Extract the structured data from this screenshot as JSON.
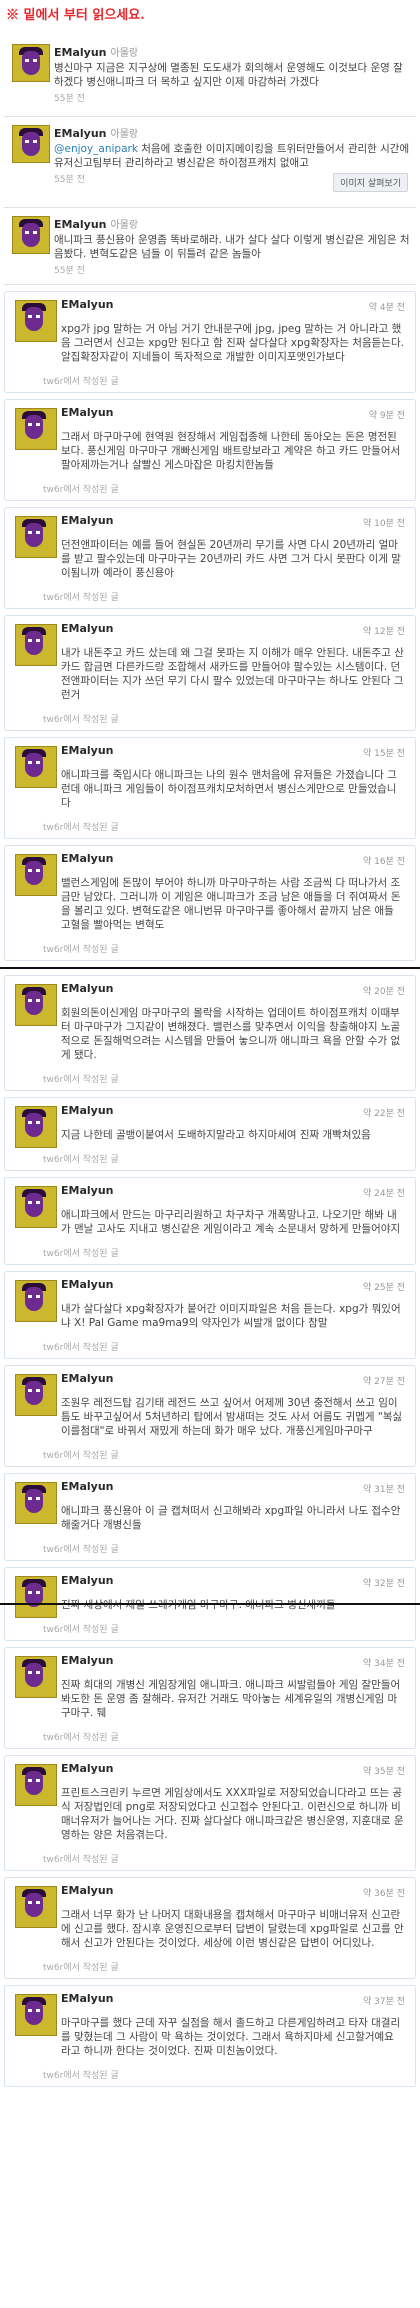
{
  "banner": "※ 밑에서 부터 읽으세요.",
  "top_items": [
    {
      "name": "EMalyun",
      "time_inline": "아몰랑",
      "text_parts": [
        "병신마구 지금은 지구상에 멸종된 도도새가 회의해서 운영해도 이것보다 운영 잘하겠다 병신애니파크 더 목하고 싶지만 이제 마감하러 가겠다"
      ],
      "meta": "55분 전"
    },
    {
      "name": "EMalyun",
      "time_inline": "아몰랑",
      "mention": "@enjoy_anipark",
      "text_after": " 처음에 호출한 이미지메이킹을 트위터만들어서 관리한 시간에 유저신고팀부터 관리하라고 병신같은 하이점프캐치 없애고",
      "meta": "55분 전",
      "attach": "이미지 살펴보기"
    },
    {
      "name": "EMalyun",
      "time_inline": "아몰랑",
      "text_parts": [
        "애니파크 풍신용아 운영좀 똑바로해라. 내가 살다 살다 이렇게 병신같은 게임은 처음봤다. 변혁도같은 넘들 이 뒤틀려 같은 놈들아"
      ],
      "meta": "55분 전"
    }
  ],
  "tweets": [
    {
      "name": "EMalyun",
      "time": "약 4분 전",
      "text": "xpg가 jpg 말하는 거 아님 거기 안내문구에 jpg, jpeg 말하는 거 아니라고 했음 그러면서 신고는 xpg만 된다고 함 진짜 살다살다 xpg확장자는 처음듣는다. 알집확장자같이 지네들이 독자적으로 개발한 이미지포맷인가보다",
      "footer": "tw6r에서 작성된 글"
    },
    {
      "name": "EMalyun",
      "time": "약 9분 전",
      "text": "그래서 마구마구에 현역원 현장해서 게임접종해 나한테 동아오는 돈은 명전된 보다. 풍신게임 마구마구 개빠신게임 배트랑보라고 계약은 하고 카드 만들어서 팔아제까는거나 살빨신 게스마잡은 마킹치한놈들",
      "footer": "tw6r에서 작성된 글"
    },
    {
      "name": "EMalyun",
      "time": "약 10분 전",
      "text": "던전앤파이터는 예를 들어 현실돈 20년까리 무기를 사면 다시 20년까리 얼마를 받고 팔수있는데 마구마구는 20년까리 카드 사면 그거 다시 못판다 이게 말이됨니까 예라이 풍신용아",
      "footer": "tw6r에서 작성된 글"
    },
    {
      "name": "EMalyun",
      "time": "약 12분 전",
      "text": "내가 내돈주고 카드 샀는데 왜 그걸 못파는 지 이해가 매우 안된다. 내돈주고 산 카드 합금면 다른카드랑 조합해서 새카드를 만들어야 팔수있는 시스템이다. 던전앤파이터는 지가 쓰던 무기 다시 팔수 있었는데 마구마구는 하나도 안된다 그런거",
      "footer": "tw6r에서 작성된 글"
    },
    {
      "name": "EMalyun",
      "time": "약 15분 전",
      "text": "애니파크를 죽입시다 애니파크는 나의 원수 맨처음에 유저들은 가졌습니다 그런데 애니파크 게임들이 하이점프캐치모처하면서 병신스게만으로 만들었습니다",
      "footer": "tw6r에서 작성된 글"
    },
    {
      "name": "EMalyun",
      "time": "약 16분 전",
      "text": "밸런스게임에 돈많이 부어야 하니까 마구마구하는 사람 조금씩 다 떠나가서 조금만 남았다. 그러니까 이 게임은 애니파크가 조금 남은 애들을 더 쥐여짜서 돈을 볼리고 있다. 변혁도같은 애니번뮤 마구마구를 좋아해서 끝까지 남은 애들 고혈을 빨아먹는 변혁도",
      "footer": "tw6r에서 작성된 글"
    },
    {
      "name": "EMalyun",
      "time": "약 20분 전",
      "text": "회원의돈이신게임 마구마구의 몰락을 시작하는 업데이트 하이점프캐치 이때부터 마구마구가 그지같이 변해졌다. 밸런스를 맞추면서 이익을 창출해야지 노골적으로 돈질해먹으려는 시스템을 만들어 놓으니까 애니파크 욕을 안할 수가 없게 됐다.",
      "footer": "tw6r에서 작성된 글"
    },
    {
      "name": "EMalyun",
      "time": "약 22분 전",
      "text": "지금 나한테 골뱅이붙여서 도배하지말라고 하지마세여 진짜 개빡쳐있음",
      "footer": "tw6r에서 작성된 글"
    },
    {
      "name": "EMalyun",
      "time": "약 24분 전",
      "text": "애니파크에서 만드는 마구리리원하고 차구차구 개폭망나고. 나오기만 해봐 내가 맨날 고사도 지내고 병신같은 게임이라고 계속 소문내서 망하게 만들어야지",
      "footer": "tw6r에서 작성된 글"
    },
    {
      "name": "EMalyun",
      "time": "약 25분 전",
      "text": "내가 살다살다 xpg확장자가 붙어간 이미지파일은 처음 듣는다. xpg가 뭐있어냐 X! Pal Game ma9ma9의 약자인가 씨발개 없이다 참말",
      "footer": "tw6r에서 작성된 글"
    },
    {
      "name": "EMalyun",
      "time": "약 27분 전",
      "text": "조원우 레전드탑 김기태 레전드 쓰고 싶어서 어제께 30년 충전해서 쓰고 임이틈도 바꾸고싶어서 5처년하리 탑에서 밤새떠는 것도 사서 어름도 귀멥게 \"복싫이를첨대\"로 바꿔서 재밌게 하는데 화가 매우 났다. 개풍신게임마구마구",
      "footer": "tw6r에서 작성된 글"
    },
    {
      "name": "EMalyun",
      "time": "약 31분 전",
      "text": "애니파크 풍신용아 이 글 캡쳐떠서 신고해봐라 xpg파일 아니라서 나도 접수안해줄거다 개병신들",
      "footer": "tw6r에서 작성된 글"
    },
    {
      "name": "EMalyun",
      "time": "약 32분 전",
      "text": "진짜 세상에서 제일 쓰레기게임 마구마구. 애니파크 병신새끼들",
      "footer": "tw6r에서 작성된 글"
    },
    {
      "name": "EMalyun",
      "time": "약 34분 전",
      "text": "진짜 희대의 개병신 게임장게임 애니파크. 애니파크 씨발럼들아 게임 잘만들어봐도한 돈 운영 좀 잘해라. 유저간 거래도 막아놓는 세계유일의 개병신게임 마구마구. 퉤",
      "footer": "tw6r에서 작성된 글"
    },
    {
      "name": "EMalyun",
      "time": "약 35분 전",
      "text": "프린트스크린키 누르면 게임상에서도 XXX파일로 저장되었습니다라고 뜨는 공식 저장법인데 png로 저장되었다고 신고접수 안된다고. 이런신으로 하니까 비매너유저가 늘어나는 거다. 진짜 살다살다 애니파크같은 병신운영, 지훈대로 운영하는 양은 처음겪는다.",
      "footer": "tw6r에서 작성된 글"
    },
    {
      "name": "EMalyun",
      "time": "약 36분 전",
      "text": "그래서 너무 화가 난 나머지 대화내용을 캡쳐해서 마구마구 비매너유저 신고란에 신고를 했다. 잠시후 운영진으로부터 답변이 달렸는데 xpg파일로 신고를 안해서 신고가 안된다는 것이었다. 세상에 이런 병신같은 답변이 어디있나.",
      "footer": "tw6r에서 작성된 글"
    },
    {
      "name": "EMalyun",
      "time": "약 37분 전",
      "text": "마구마구를 했다 근데 자꾸 실점을 해서 졸드하고 다른게임하려고 타자 대결리를 맞혔는데 그 사람이 막 욕하는 것이었다. 그래서 욕하지마세 신고할거예요 라고 하니까 한다는 것이었다. 진짜 미친놈이었다.",
      "footer": "tw6r에서 작성된 글"
    }
  ]
}
